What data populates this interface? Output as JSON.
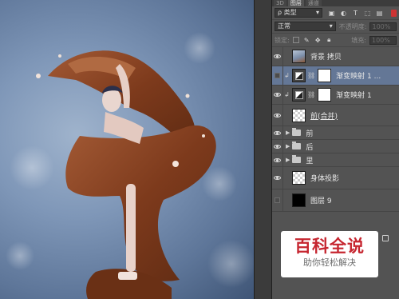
{
  "panel": {
    "tabs": [
      "3D",
      "图层",
      "通道"
    ],
    "filter": {
      "kind_label": "ρ 类型"
    },
    "blend_mode": "正常",
    "opacity_label": "不透明度:",
    "opacity_value": "100%",
    "lock_label": "锁定:",
    "fill_label": "填充:",
    "fill_value": "100%"
  },
  "layers": [
    {
      "name": "背景 拷贝",
      "visible": true,
      "selected": false,
      "thumb": "photo"
    },
    {
      "name": "渐变映射 1 ...",
      "visible": false,
      "selected": true,
      "thumb": "adjustment"
    },
    {
      "name": "渐变映射 1",
      "visible": true,
      "selected": false,
      "thumb": "adjustment"
    },
    {
      "name": "前(合并)",
      "visible": true,
      "selected": false,
      "thumb": "checker"
    },
    {
      "name": "前",
      "visible": true,
      "selected": false,
      "thumb": "folder"
    },
    {
      "name": "后",
      "visible": true,
      "selected": false,
      "thumb": "folder"
    },
    {
      "name": "里",
      "visible": true,
      "selected": false,
      "thumb": "folder"
    },
    {
      "name": "身体投影",
      "visible": true,
      "selected": false,
      "thumb": "checker"
    },
    {
      "name": "图层 9",
      "visible": false,
      "selected": false,
      "thumb": "black"
    }
  ],
  "watermark": {
    "title": "百科全说",
    "subtitle": "助你轻松解决"
  },
  "colors": {
    "chocolate": "#8a4324",
    "selection": "#647796",
    "watermark_red": "#c62630"
  }
}
